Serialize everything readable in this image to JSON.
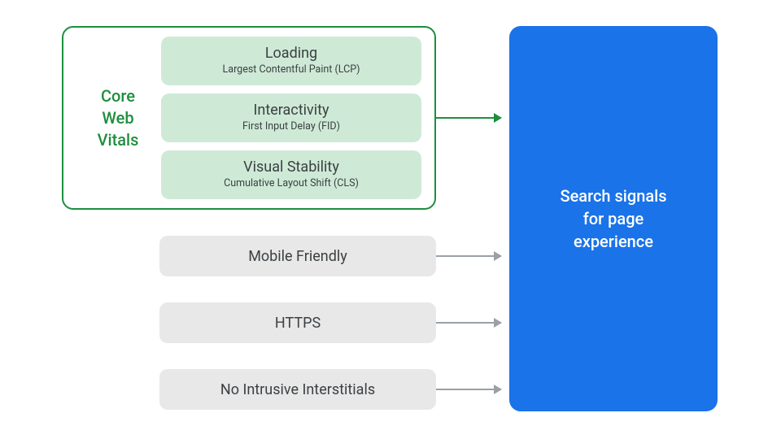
{
  "core_web_vitals": {
    "label_line1": "Core",
    "label_line2": "Web",
    "label_line3": "Vitals",
    "items": [
      {
        "title": "Loading",
        "subtitle": "Largest Contentful Paint (LCP)"
      },
      {
        "title": "Interactivity",
        "subtitle": "First Input Delay (FID)"
      },
      {
        "title": "Visual Stability",
        "subtitle": "Cumulative Layout Shift (CLS)"
      }
    ]
  },
  "other_signals": [
    "Mobile Friendly",
    "HTTPS",
    "No Intrusive Interstitials"
  ],
  "target": {
    "line1": "Search signals",
    "line2": "for page",
    "line3": "experience"
  },
  "colors": {
    "green": "#1e8e3e",
    "vital_bg": "#ceead6",
    "grey_pill": "#e8e8e8",
    "blue": "#1a73e8",
    "arrow_grey": "#9aa0a6",
    "text": "#3c4043"
  }
}
